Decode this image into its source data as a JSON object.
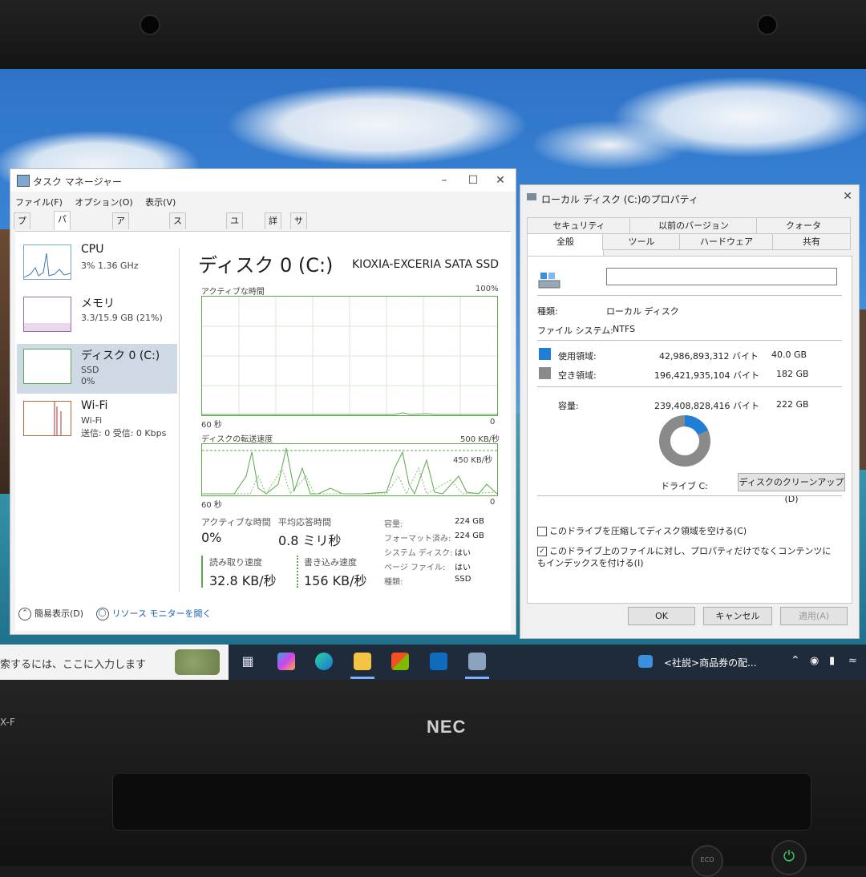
{
  "task_manager": {
    "title": "タスク マネージャー",
    "menu": [
      "ファイル(F)",
      "オプション(O)",
      "表示(V)"
    ],
    "tabs": [
      "プロセス",
      "パフォーマンス",
      "アプリの履歴",
      "スタートアップ",
      "ユーザー",
      "詳細",
      "サービス"
    ],
    "sidebar": [
      {
        "name": "CPU",
        "sub1": "3%  1.36 GHz",
        "sub2": ""
      },
      {
        "name": "メモリ",
        "sub1": "3.3/15.9 GB (21%)",
        "sub2": ""
      },
      {
        "name": "ディスク 0 (C:)",
        "sub1": "SSD",
        "sub2": "0%"
      },
      {
        "name": "Wi-Fi",
        "sub1": "Wi-Fi",
        "sub2": "送信: 0  受信: 0 Kbps"
      }
    ],
    "disk_title": "ディスク 0 (C:)",
    "disk_model": "KIOXIA-EXCERIA SATA SSD",
    "graph1": {
      "label": "アクティブな時間",
      "max": "100%",
      "time": "60 秒",
      "min": "0"
    },
    "graph2": {
      "label": "ディスクの転送速度",
      "max": "500 KB/秒",
      "mid": "450 KB/秒",
      "time": "60 秒",
      "min": "0"
    },
    "stats": {
      "active_label": "アクティブな時間",
      "active_value": "0%",
      "resp_label": "平均応答時間",
      "resp_value": "0.8 ミリ秒",
      "read_label": "読み取り速度",
      "read_value": "32.8 KB/秒",
      "write_label": "書き込み速度",
      "write_value": "156 KB/秒"
    },
    "details": [
      {
        "k": "容量:",
        "v": "224 GB"
      },
      {
        "k": "フォーマット済み:",
        "v": "224 GB"
      },
      {
        "k": "システム ディスク:",
        "v": "はい"
      },
      {
        "k": "ページ ファイル:",
        "v": "はい"
      },
      {
        "k": "種類:",
        "v": "SSD"
      }
    ],
    "footer": {
      "simple": "簡易表示(D)",
      "resmon": "リソース モニターを開く"
    }
  },
  "properties": {
    "title": "ローカル ディスク (C:)のプロパティ",
    "tabs_row1": [
      "セキュリティ",
      "以前のバージョン",
      "クォータ"
    ],
    "tabs_row2": [
      "全般",
      "ツール",
      "ハードウェア",
      "共有"
    ],
    "name_value": "",
    "type_label": "種類:",
    "type_value": "ローカル ディスク",
    "fs_label": "ファイル システム:",
    "fs_value": "NTFS",
    "used_label": "使用領域:",
    "used_bytes": "42,986,893,312 バイト",
    "used_gb": "40.0 GB",
    "free_label": "空き領域:",
    "free_bytes": "196,421,935,104 バイト",
    "free_gb": "182 GB",
    "cap_label": "容量:",
    "cap_bytes": "239,408,828,416 バイト",
    "cap_gb": "222 GB",
    "used_fraction": 0.18,
    "drive_label": "ドライブ C:",
    "cleanup_button": "ディスクのクリーンアップ(D)",
    "compress_label": "このドライブを圧縮してディスク領域を空ける(C)",
    "index_label": "このドライブ上のファイルに対し、プロパティだけでなくコンテンツにもインデックスを付ける(I)",
    "ok": "OK",
    "cancel": "キャンセル",
    "apply": "適用(A)",
    "colors": {
      "used": "#1f7fd6",
      "free": "#8a8a8a"
    }
  },
  "taskbar": {
    "search_placeholder": "索するには、ここに入力します",
    "news": "<社説>商品券の配...",
    "icons": [
      "task-view-icon",
      "copilot-icon",
      "edge-icon",
      "file-explorer-icon",
      "store-icon",
      "outlook-icon",
      "task-manager-icon"
    ]
  },
  "laptop": {
    "brand": "NEC",
    "badge": "X-F",
    "eco": "ECO"
  }
}
